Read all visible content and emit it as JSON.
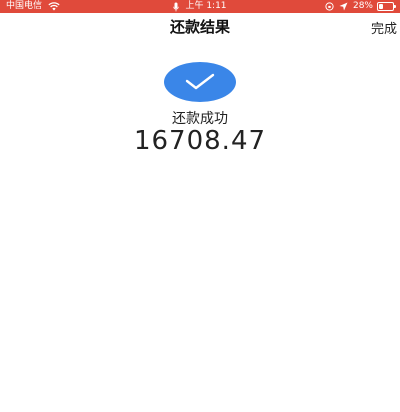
{
  "status_bar": {
    "carrier": "中国电信",
    "time": "上午 1:11",
    "battery": "28%",
    "battery_level": 0.28
  },
  "nav": {
    "title": "还款结果",
    "done_label": "完成"
  },
  "result": {
    "status": "还款成功",
    "amount": "16708.47"
  },
  "icons": {
    "success": "check-icon",
    "wifi": "wifi-icon",
    "mic": "microphone-icon",
    "location": "location-arrow-icon",
    "lock": "rotation-lock-icon"
  },
  "colors": {
    "status_bar": "#e04a3b",
    "accent": "#3a86e8"
  }
}
